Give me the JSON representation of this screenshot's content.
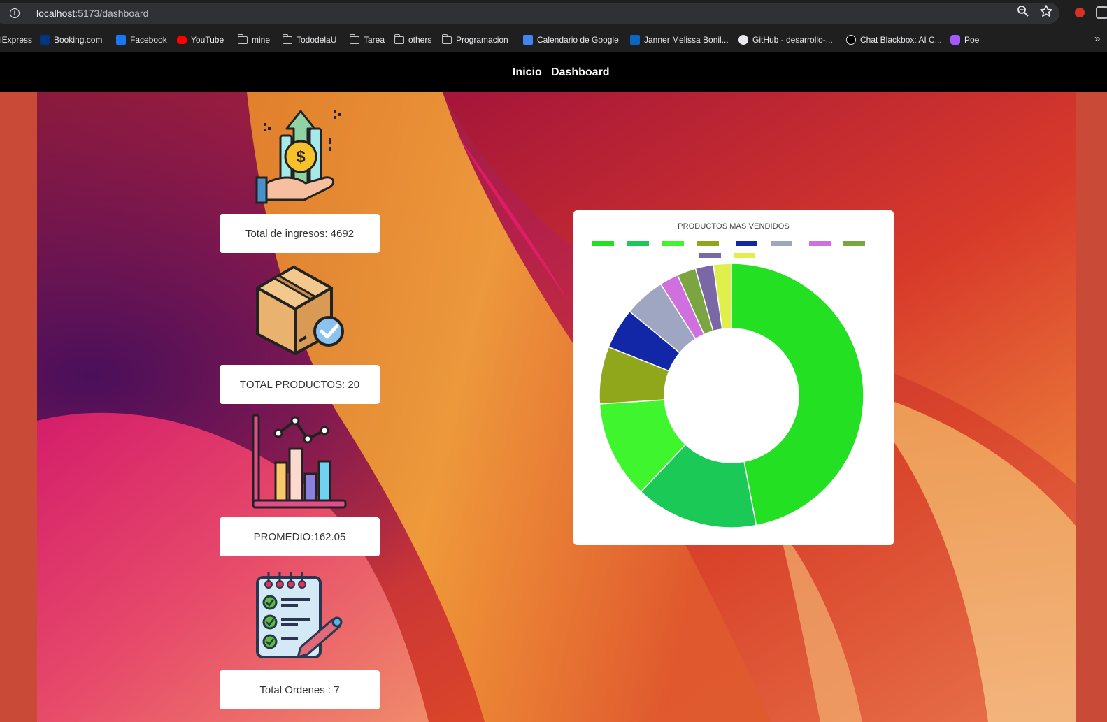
{
  "browser": {
    "url_host": "localhost",
    "url_path": ":5173/dashboard",
    "bookmarks": [
      {
        "label": "iExpress",
        "icon": "none"
      },
      {
        "label": "Booking.com",
        "icon": "booking-icon"
      },
      {
        "label": "Facebook",
        "icon": "facebook-icon"
      },
      {
        "label": "YouTube",
        "icon": "youtube-icon"
      },
      {
        "label": "mine",
        "icon": "folder-icon"
      },
      {
        "label": "TododelaU",
        "icon": "folder-icon"
      },
      {
        "label": "Tarea",
        "icon": "folder-icon"
      },
      {
        "label": "others",
        "icon": "folder-icon"
      },
      {
        "label": "Programacion",
        "icon": "folder-icon"
      },
      {
        "label": "Calendario de Google",
        "icon": "calendar-icon"
      },
      {
        "label": "Janner Melissa Bonil...",
        "icon": "linkedin-icon"
      },
      {
        "label": "GitHub - desarrollo-...",
        "icon": "github-icon"
      },
      {
        "label": "Chat Blackbox: AI C...",
        "icon": "blackbox-icon"
      },
      {
        "label": "Poe",
        "icon": "poe-icon"
      }
    ],
    "more_bookmarks": "»"
  },
  "nav": {
    "inicio": "Inicio",
    "dashboard": "Dashboard"
  },
  "stats": {
    "ingresos": "Total de ingresos: 4692",
    "productos": "TOTAL PRODUCTOS: 20",
    "promedio": "PROMEDIO:162.05",
    "ordenes": "Total Ordenes : 7"
  },
  "chart_data": {
    "type": "pie",
    "title": "PRODUCTOS MAS VENDIDOS",
    "donut": true,
    "legend_position": "top",
    "legend_labels_visible": false,
    "series": [
      {
        "color": "#23e022",
        "value": 47
      },
      {
        "color": "#1bc957",
        "value": 15
      },
      {
        "color": "#3ef52e",
        "value": 12
      },
      {
        "color": "#90a71b",
        "value": 7
      },
      {
        "color": "#1127a8",
        "value": 5
      },
      {
        "color": "#9fa6c2",
        "value": 5
      },
      {
        "color": "#d070df",
        "value": 2.3
      },
      {
        "color": "#7ba540",
        "value": 2.3
      },
      {
        "color": "#7a67a6",
        "value": 2.2
      },
      {
        "color": "#dff04c",
        "value": 2.2
      }
    ]
  }
}
